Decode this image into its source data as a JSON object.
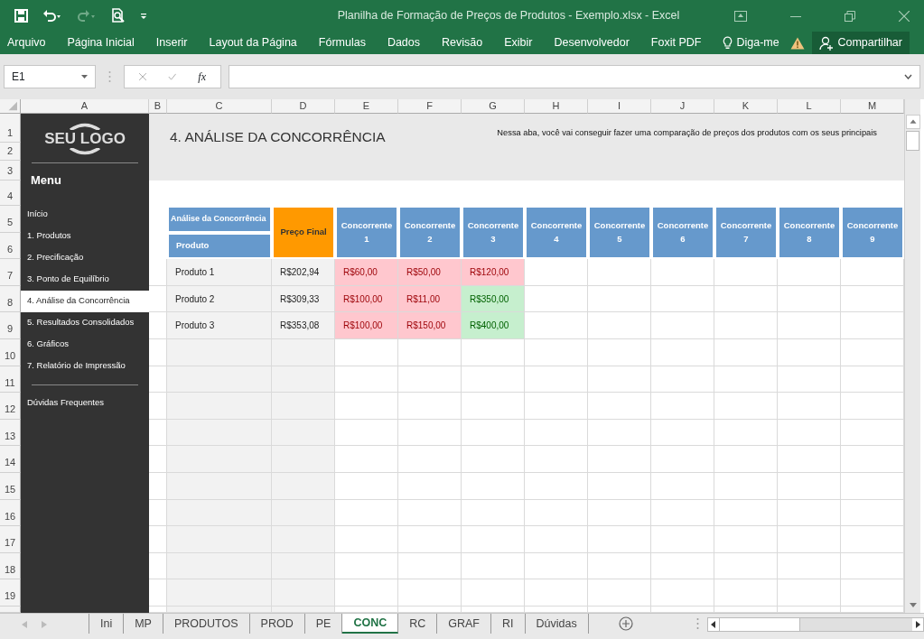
{
  "title_bar": {
    "title": "Planilha de Formação de Preços de Produtos - Exemplo.xlsx - Excel"
  },
  "ribbon": {
    "tabs": [
      {
        "label": "Arquivo"
      },
      {
        "label": "Página Inicial"
      },
      {
        "label": "Inserir"
      },
      {
        "label": "Layout da Página"
      },
      {
        "label": "Fórmulas"
      },
      {
        "label": "Dados"
      },
      {
        "label": "Revisão"
      },
      {
        "label": "Exibir"
      },
      {
        "label": "Desenvolvedor"
      },
      {
        "label": "Foxit PDF"
      }
    ],
    "tell_me": "Diga-me",
    "share_button": "Compartilhar"
  },
  "formula_bar": {
    "name_box": "E1",
    "function_label": "fx"
  },
  "columns": [
    "A",
    "B",
    "C",
    "D",
    "E",
    "F",
    "G",
    "H",
    "I",
    "J",
    "K",
    "L",
    "M"
  ],
  "rows": [
    "1",
    "2",
    "3",
    "4",
    "5",
    "6",
    "7",
    "8",
    "9",
    "10",
    "11",
    "12",
    "13",
    "14",
    "15",
    "16",
    "17",
    "18",
    "19"
  ],
  "sidebar": {
    "logo": "SEU LOGO",
    "menu_title": "Menu",
    "items": [
      {
        "label": "Início",
        "selected": false
      },
      {
        "label": "1. Produtos",
        "selected": false
      },
      {
        "label": "2. Precificação",
        "selected": false
      },
      {
        "label": "3. Ponto de Equilíbrio",
        "selected": false
      },
      {
        "label": "4. Análise da Concorrência",
        "selected": true
      },
      {
        "label": "5. Resultados Consolidados",
        "selected": false
      },
      {
        "label": "6. Gráficos",
        "selected": false
      },
      {
        "label": "7. Relatório de Impressão",
        "selected": false
      }
    ],
    "footer_item": "Dúvidas Frequentes"
  },
  "header": {
    "title": "4. ANÁLISE DA CONCORRÊNCIA",
    "description": "Nessa aba, você vai conseguir fazer uma comparação de preços dos produtos com os seus principais"
  },
  "table": {
    "group_label": "Análise da Concorrência",
    "product_header": "Produto",
    "price_header": "Preço Final",
    "competitors": [
      "Concorrente 1",
      "Concorrente 2",
      "Concorrente 3",
      "Concorrente 4",
      "Concorrente 5",
      "Concorrente 6",
      "Concorrente 7",
      "Concorrente 8",
      "Concorrente 9"
    ],
    "rows": [
      {
        "product": "Produto 1",
        "price": "R$202,94",
        "values": [
          {
            "text": "R$60,00",
            "color": "#ffc7ce"
          },
          {
            "text": "R$50,00",
            "color": "#ffc7ce"
          },
          {
            "text": "R$120,00",
            "color": "#ffc7ce"
          }
        ]
      },
      {
        "product": "Produto 2",
        "price": "R$309,33",
        "values": [
          {
            "text": "R$100,00",
            "color": "#ffc7ce"
          },
          {
            "text": "R$11,00",
            "color": "#ffc7ce"
          },
          {
            "text": "R$350,00",
            "color": "#c6efce"
          }
        ]
      },
      {
        "product": "Produto 3",
        "price": "R$353,08",
        "values": [
          {
            "text": "R$100,00",
            "color": "#ffc7ce"
          },
          {
            "text": "R$150,00",
            "color": "#ffc7ce"
          },
          {
            "text": "R$400,00",
            "color": "#c6efce"
          }
        ]
      }
    ]
  },
  "sheet_tabs": [
    {
      "label": "Ini",
      "selected": false
    },
    {
      "label": "MP",
      "selected": false
    },
    {
      "label": "PRODUTOS",
      "selected": false
    },
    {
      "label": "PROD",
      "selected": false
    },
    {
      "label": "PE",
      "selected": false
    },
    {
      "label": "CONC",
      "selected": true
    },
    {
      "label": "RC",
      "selected": false
    },
    {
      "label": "GRAF",
      "selected": false
    },
    {
      "label": "RI",
      "selected": false
    },
    {
      "label": "Dúvidas",
      "selected": false
    }
  ]
}
